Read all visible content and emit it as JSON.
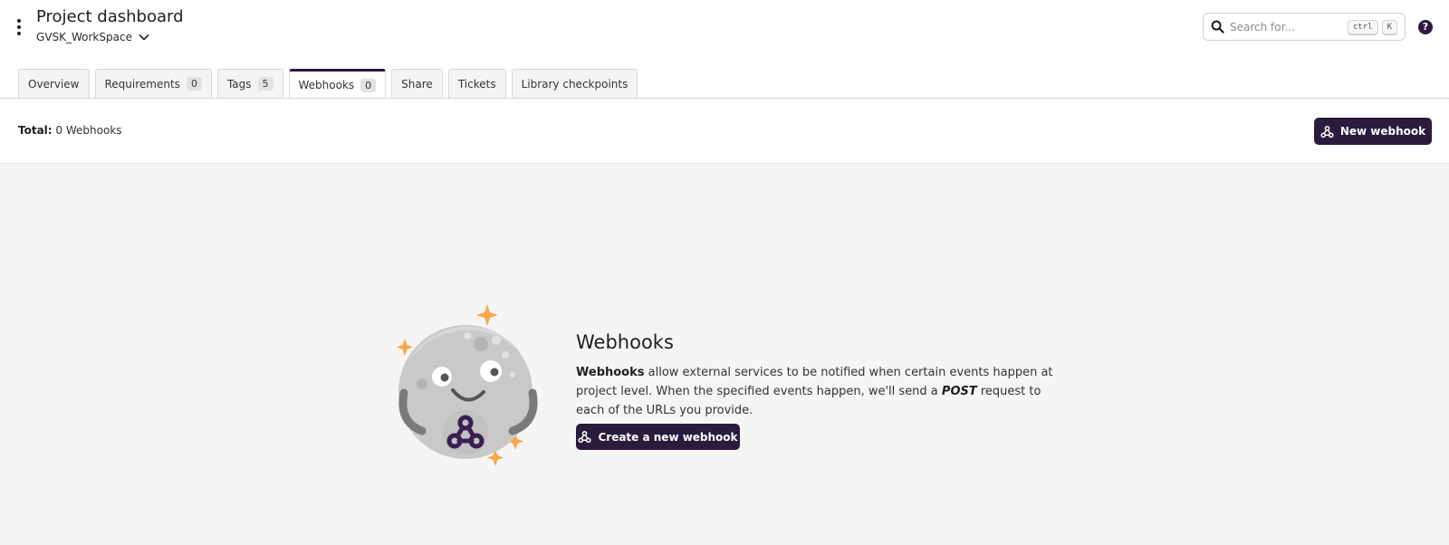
{
  "header": {
    "title": "Project dashboard",
    "workspace": "GVSK_WorkSpace",
    "search_placeholder": "Search for...",
    "shortcut_keys": [
      "ctrl",
      "K"
    ],
    "help_label": "?"
  },
  "tabs": [
    {
      "label": "Overview",
      "count": null
    },
    {
      "label": "Requirements",
      "count": "0"
    },
    {
      "label": "Tags",
      "count": "5"
    },
    {
      "label": "Webhooks",
      "count": "0",
      "active": true
    },
    {
      "label": "Share",
      "count": null
    },
    {
      "label": "Tickets",
      "count": null
    },
    {
      "label": "Library checkpoints",
      "count": null
    }
  ],
  "toolbar": {
    "total_label": "Total:",
    "total_value": "0 Webhooks",
    "new_button": "New webhook"
  },
  "empty_state": {
    "title": "Webhooks",
    "desc_bold": "Webhooks",
    "desc_part1": " allow external services to be notified when certain events happen at project level. When the specified events happen, we'll send a ",
    "desc_method": "POST",
    "desc_part2": " request to each of the URLs you provide.",
    "button": "Create a new webhook"
  },
  "colors": {
    "brand": "#2b1b3d",
    "sparkle": "#f6a94a",
    "page_bg": "#f5f5f5"
  },
  "icons": {
    "menu": "kebab-menu-icon",
    "workspace_toggle": "chevron-down-icon",
    "search": "search-icon",
    "help": "help-icon",
    "webhook": "webhook-icon"
  }
}
